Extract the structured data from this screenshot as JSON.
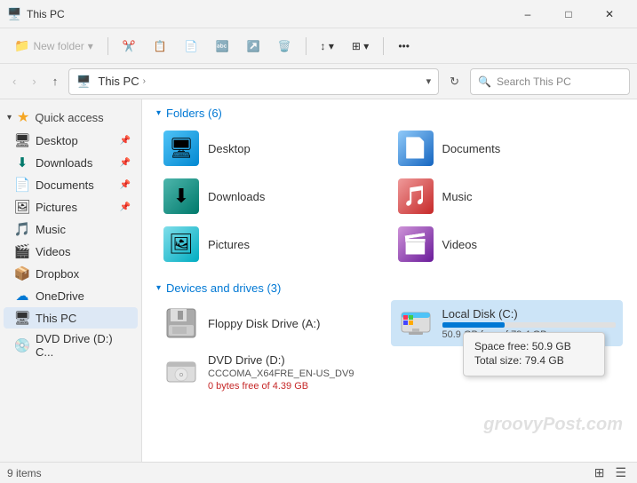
{
  "titlebar": {
    "icon": "🖥️",
    "title": "This PC",
    "minimize": "–",
    "maximize": "□",
    "close": "✕"
  },
  "toolbar": {
    "new_folder": "New folder",
    "dropdown_arrow": "▾"
  },
  "addressbar": {
    "back": "‹",
    "forward": "›",
    "up": "↑",
    "crumb1": "This PC",
    "crumb_sep": "›",
    "refresh": "↻",
    "search_placeholder": "Search This PC"
  },
  "sidebar": {
    "quick_access_label": "Quick access",
    "items": [
      {
        "id": "desktop",
        "label": "Desktop",
        "pinned": true,
        "icon": "🖥"
      },
      {
        "id": "downloads",
        "label": "Downloads",
        "pinned": true,
        "icon": "⬇"
      },
      {
        "id": "documents",
        "label": "Documents",
        "pinned": true,
        "icon": "📄"
      },
      {
        "id": "pictures",
        "label": "Pictures",
        "pinned": true,
        "icon": "🖼"
      },
      {
        "id": "music",
        "label": "Music",
        "pinned": false,
        "icon": "🎵"
      },
      {
        "id": "videos",
        "label": "Videos",
        "pinned": false,
        "icon": "🎬"
      },
      {
        "id": "dropbox",
        "label": "Dropbox",
        "pinned": false,
        "icon": "📦"
      },
      {
        "id": "onedrive",
        "label": "OneDrive",
        "pinned": false,
        "icon": "☁"
      },
      {
        "id": "thispc",
        "label": "This PC",
        "pinned": false,
        "icon": "🖥",
        "active": true
      },
      {
        "id": "dvddrive",
        "label": "DVD Drive (D:) C...",
        "pinned": false,
        "icon": "💿"
      }
    ]
  },
  "content": {
    "folders_section": "Folders (6)",
    "drives_section": "Devices and drives (3)",
    "folders": [
      {
        "id": "desktop",
        "name": "Desktop"
      },
      {
        "id": "documents",
        "name": "Documents"
      },
      {
        "id": "downloads",
        "name": "Downloads"
      },
      {
        "id": "music",
        "name": "Music"
      },
      {
        "id": "pictures",
        "name": "Pictures"
      },
      {
        "id": "videos",
        "name": "Videos"
      }
    ],
    "drives": [
      {
        "id": "floppy",
        "name": "Floppy Disk Drive (A:)",
        "free": "",
        "total": "",
        "percent": 0,
        "has_bar": false
      },
      {
        "id": "localc",
        "name": "Local Disk (C:)",
        "free": "50.9 GB free of 79.4 GB",
        "total": "79.4 GB",
        "free_gb": "50.9 GB",
        "percent": 36,
        "has_bar": true,
        "selected": true
      },
      {
        "id": "dvdd",
        "name": "DVD Drive (D:)",
        "subtitle": "CCCOMA_X64FRE_EN-US_DV9",
        "free": "0 bytes free of 4.39 GB",
        "has_bar": false
      }
    ],
    "tooltip": {
      "space_free_label": "Space free:",
      "space_free_val": "50.9 GB",
      "total_size_label": "Total size:",
      "total_size_val": "79.4 GB"
    }
  },
  "statusbar": {
    "count": "9 items",
    "view1": "⊞",
    "view2": "☰"
  },
  "watermark": "groovyPost.com"
}
